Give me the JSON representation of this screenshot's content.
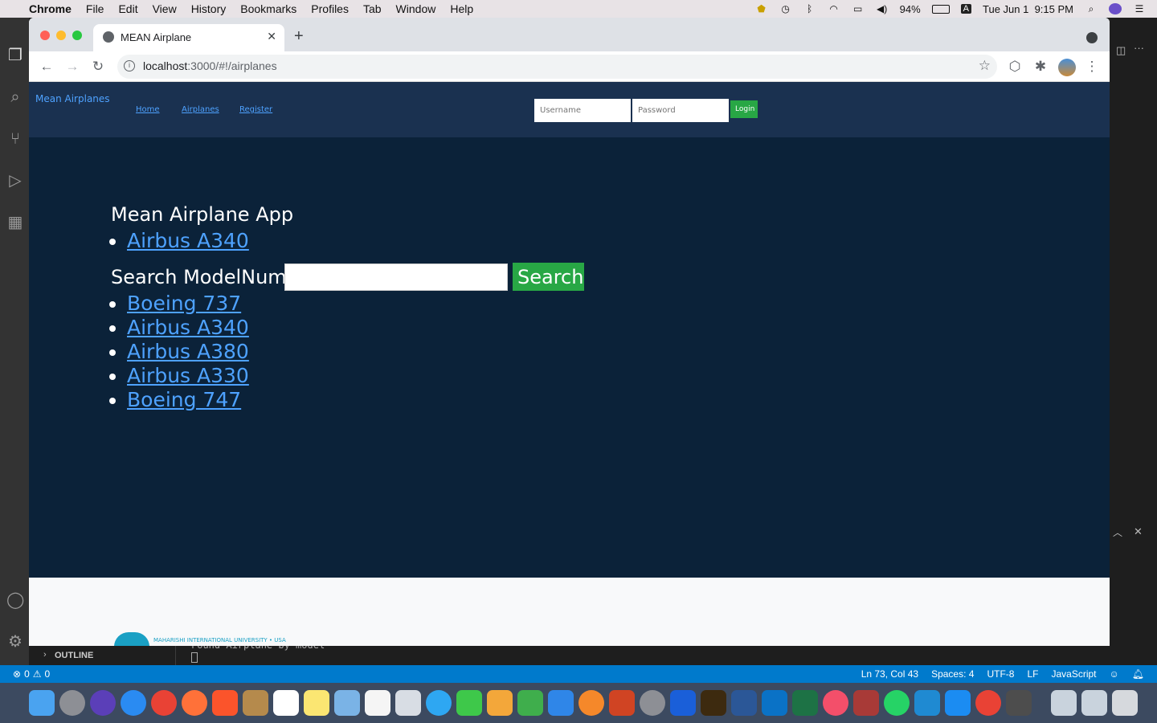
{
  "menubar": {
    "app_name": "Chrome",
    "menus": [
      "File",
      "Edit",
      "View",
      "History",
      "Bookmarks",
      "Profiles",
      "Tab",
      "Window",
      "Help"
    ],
    "battery": "94%",
    "input_source": "A",
    "datetime": "Tue Jun 1  9:15 PM"
  },
  "browser": {
    "tab_title": "MEAN Airplane",
    "url_host": "localhost",
    "url_rest": ":3000/#!/airplanes"
  },
  "navbar": {
    "brand": "Mean Airplanes",
    "links": [
      "Home",
      "Airplanes",
      "Register"
    ],
    "username_placeholder": "Username",
    "password_placeholder": "Password",
    "login_label": "Login"
  },
  "main": {
    "title": "Mean Airplane App",
    "featured": [
      "Airbus A340"
    ],
    "search_label": "Search ModelNum:",
    "search_button": "Search",
    "airplanes": [
      "Boeing 737",
      "Airbus A340",
      "Airbus A380",
      "Airbus A330",
      "Boeing 747"
    ]
  },
  "footer": {
    "logo_text": "MAHARISHI INTERNATIONAL UNIVERSITY • USA"
  },
  "vscode": {
    "outline_label": "OUTLINE",
    "terminal_text": "Found Airplane by model",
    "errors": "0",
    "warnings": "0",
    "cursor": "Ln 73, Col 43",
    "spaces": "Spaces: 4",
    "encoding": "UTF-8",
    "eol": "LF",
    "language": "JavaScript"
  }
}
